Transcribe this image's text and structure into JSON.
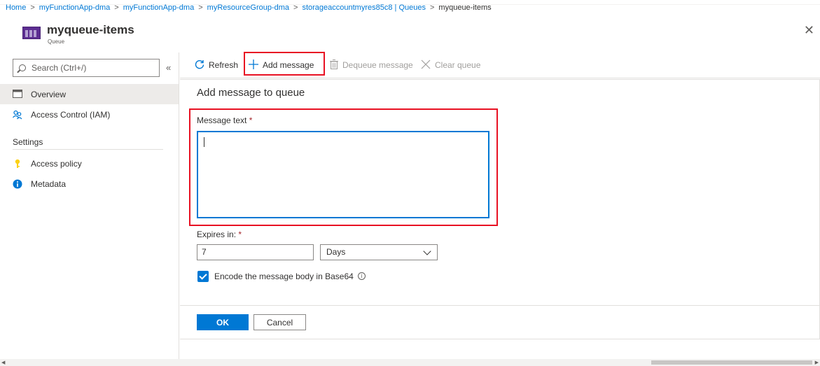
{
  "breadcrumb": [
    {
      "label": "Home"
    },
    {
      "label": "myFunctionApp-dma"
    },
    {
      "label": "myFunctionApp-dma"
    },
    {
      "label": "myResourceGroup-dma"
    },
    {
      "label": "storageaccountmyres85c8 | Queues"
    },
    {
      "label": "myqueue-items"
    }
  ],
  "breadcrumb_sep": ">",
  "header": {
    "title": "myqueue-items",
    "subtitle": "Queue",
    "close": "✕"
  },
  "sidebar": {
    "search_placeholder": "Search (Ctrl+/)",
    "collapse": "«",
    "items": [
      {
        "label": "Overview",
        "icon": "overview-icon"
      },
      {
        "label": "Access Control (IAM)",
        "icon": "people-icon"
      }
    ],
    "settings_header": "Settings",
    "settings_items": [
      {
        "label": "Access policy",
        "icon": "key-icon"
      },
      {
        "label": "Metadata",
        "icon": "info-icon"
      }
    ]
  },
  "toolbar": {
    "refresh": "Refresh",
    "add_message": "Add message",
    "dequeue_message": "Dequeue message",
    "clear_queue": "Clear queue"
  },
  "panel": {
    "title": "Add message to queue",
    "message_label": "Message text",
    "message_value": "",
    "required_mark": "*",
    "expires_label": "Expires in:",
    "expires_value": "7",
    "expires_unit": "Days",
    "encode_label": "Encode the message body in Base64",
    "encode_checked": true,
    "ok": "OK",
    "cancel": "Cancel"
  },
  "colors": {
    "accent": "#0078d4",
    "highlight": "#e81123",
    "required": "#a4262c"
  }
}
